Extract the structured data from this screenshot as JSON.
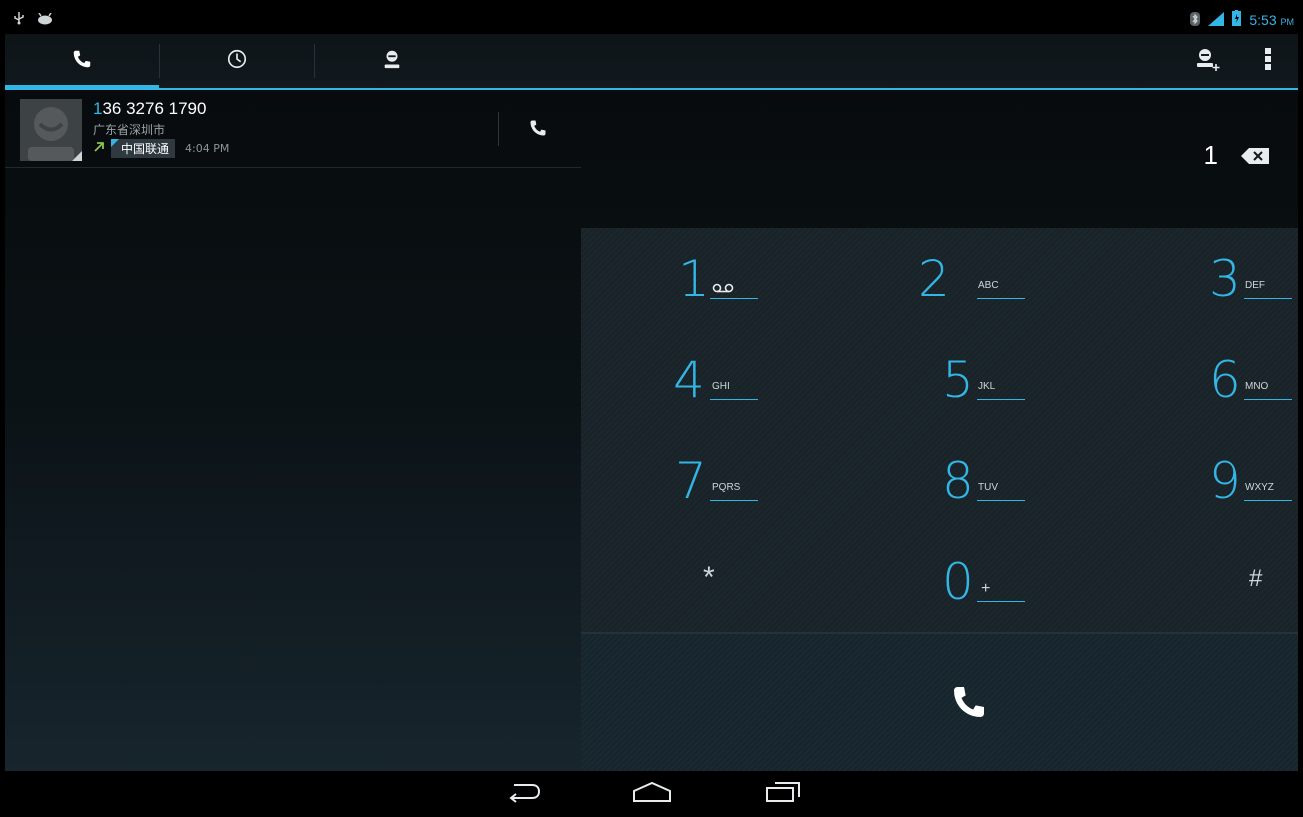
{
  "status_bar": {
    "left_icons": [
      "usb-icon",
      "android-debug-icon"
    ],
    "right_icons": [
      "bluetooth-icon",
      "signal-icon",
      "battery-icon"
    ],
    "time": "5:53",
    "ampm": "PM"
  },
  "tabs": [
    {
      "name": "tab-dialer",
      "icon": "phone-icon",
      "selected": true
    },
    {
      "name": "tab-call-log",
      "icon": "clock-icon",
      "selected": false
    },
    {
      "name": "tab-contacts",
      "icon": "person-icon",
      "selected": false
    }
  ],
  "actions": [
    "add-contact-icon",
    "overflow-menu-icon"
  ],
  "call_log": [
    {
      "number_highlight": "1",
      "number_rest": "36 3276 1790",
      "location": "广东省深圳市",
      "call_type_icon": "outgoing-call-icon",
      "carrier": "中国联通",
      "time": "4:04 PM"
    }
  ],
  "dialer": {
    "digits": "1",
    "keys": [
      {
        "num": "1",
        "letters": "",
        "icon": "voicemail-icon"
      },
      {
        "num": "2",
        "letters": "ABC"
      },
      {
        "num": "3",
        "letters": "DEF"
      },
      {
        "num": "4",
        "letters": "GHI"
      },
      {
        "num": "5",
        "letters": "JKL"
      },
      {
        "num": "6",
        "letters": "MNO"
      },
      {
        "num": "7",
        "letters": "PQRS"
      },
      {
        "num": "8",
        "letters": "TUV"
      },
      {
        "num": "9",
        "letters": "WXYZ"
      },
      {
        "sym": "*"
      },
      {
        "num": "0",
        "letters": "+"
      },
      {
        "sym": "#"
      }
    ]
  },
  "nav": [
    "back-icon",
    "home-icon",
    "recent-apps-icon"
  ],
  "colors": {
    "accent": "#33b5e5",
    "outgoing": "#8bc34a"
  }
}
